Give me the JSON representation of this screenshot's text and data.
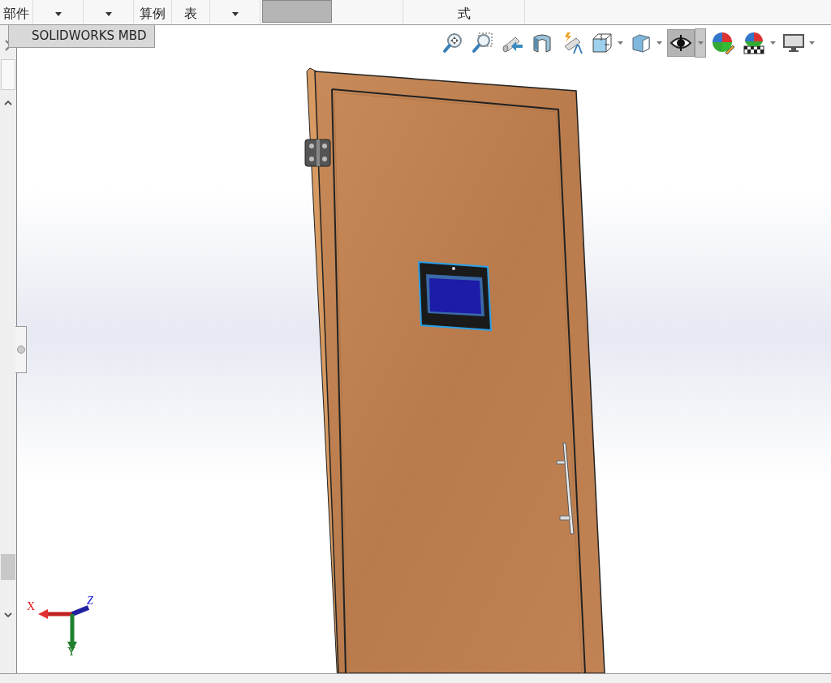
{
  "ribbon": {
    "items": [
      {
        "kind": "text",
        "label": "部件",
        "selected": false
      },
      {
        "kind": "dropdown",
        "selected": false
      },
      {
        "kind": "dropdown",
        "selected": false
      },
      {
        "kind": "text",
        "label": "算例",
        "selected": false
      },
      {
        "kind": "text",
        "label": "表",
        "selected": false
      },
      {
        "kind": "dropdown",
        "selected": false
      },
      {
        "kind": "blank",
        "selected": true
      },
      {
        "kind": "blank",
        "selected": false
      },
      {
        "kind": "text",
        "label": "式",
        "selected": false
      }
    ]
  },
  "tabs": [
    {
      "label": "SOLIDWORKS MBD",
      "selected": true
    }
  ],
  "view_toolbar": [
    {
      "kind": "zoomfit",
      "dropdown": false,
      "selected": false
    },
    {
      "kind": "zoomarea",
      "dropdown": false,
      "selected": false
    },
    {
      "kind": "previous",
      "dropdown": false,
      "selected": false
    },
    {
      "kind": "section",
      "dropdown": false,
      "selected": false
    },
    {
      "kind": "annotation",
      "dropdown": false,
      "selected": false
    },
    {
      "kind": "orientation",
      "dropdown": true,
      "selected": false
    },
    {
      "kind": "display",
      "dropdown": true,
      "selected": false
    },
    {
      "kind": "eye",
      "dropdown": true,
      "selected": true
    },
    {
      "kind": "appearance",
      "dropdown": false,
      "selected": false
    },
    {
      "kind": "scene",
      "dropdown": true,
      "selected": false
    },
    {
      "kind": "monitor",
      "dropdown": true,
      "selected": false
    }
  ],
  "triad": {
    "x_label": "X",
    "y_label": "Y",
    "z_label": "Z"
  }
}
